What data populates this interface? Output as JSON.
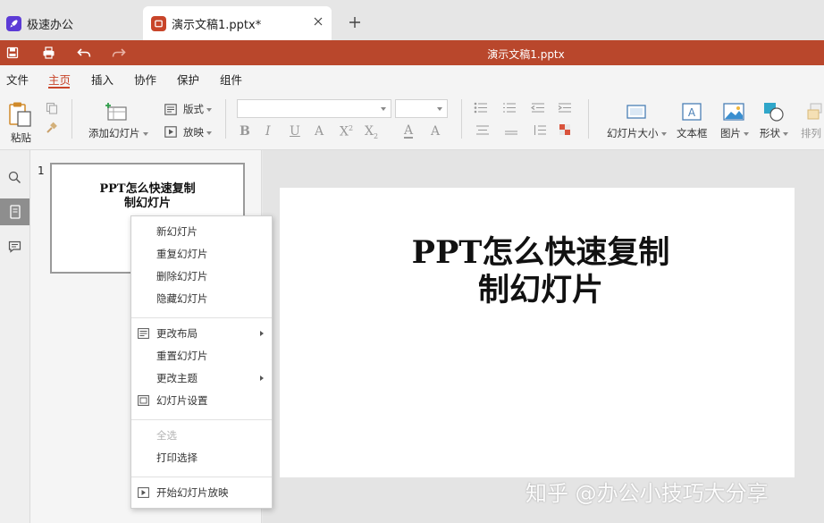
{
  "tabs": {
    "home": {
      "label": "极速办公",
      "icon": "rocket-icon"
    },
    "document": {
      "label": "演示文稿1.pptx*",
      "icon": "presentation-icon"
    },
    "add_icon": "plus-icon",
    "close_icon": "close-icon"
  },
  "titlebar": {
    "title": "演示文稿1.pptx",
    "quick_actions": [
      "save-icon",
      "print-icon",
      "undo-icon",
      "redo-icon"
    ],
    "color": "#b9472c"
  },
  "menu": {
    "items": [
      "文件",
      "主页",
      "插入",
      "协作",
      "保护",
      "组件"
    ],
    "active": "主页",
    "accent": "#c8452a"
  },
  "ribbon": {
    "paste": "粘贴",
    "add_slide": "添加幻灯片",
    "layout": "版式",
    "play": "放映",
    "slide_size": "幻灯片大小",
    "textbox": "文本框",
    "image": "图片",
    "shape": "形状",
    "arrange": "排列",
    "font_name": "",
    "font_size": ""
  },
  "thumbnail": {
    "number": "1",
    "line1": "PPT怎么快速复制",
    "line2": "制幻灯片"
  },
  "slide": {
    "line1": "PPT怎么快速复制",
    "line2": "制幻灯片"
  },
  "context_menu": {
    "new_slide": "新幻灯片",
    "duplicate_slide": "重复幻灯片",
    "delete_slide": "删除幻灯片",
    "hide_slide": "隐藏幻灯片",
    "change_layout": "更改布局",
    "reset_slide": "重置幻灯片",
    "change_theme": "更改主题",
    "slide_settings": "幻灯片设置",
    "select_all": "全选",
    "print_selection": "打印选择",
    "start_show": "开始幻灯片放映"
  },
  "watermark": "知乎 @办公小技巧大分享"
}
